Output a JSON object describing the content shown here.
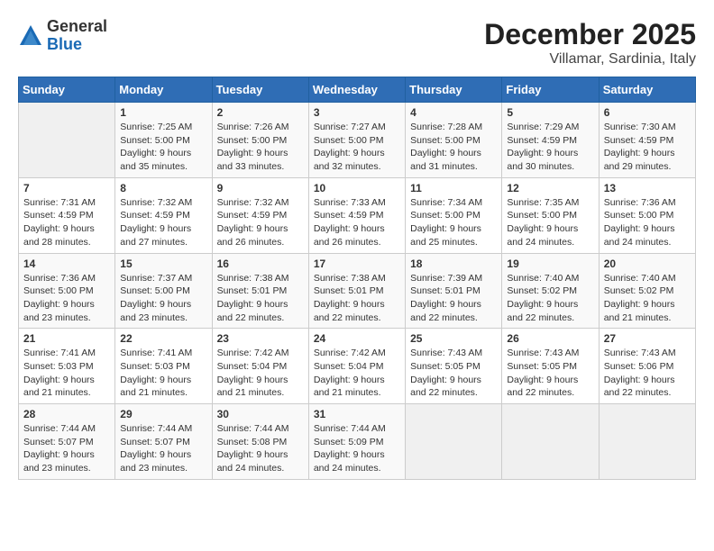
{
  "header": {
    "logo": {
      "general": "General",
      "blue": "Blue"
    },
    "title": "December 2025",
    "location": "Villamar, Sardinia, Italy"
  },
  "calendar": {
    "weekdays": [
      "Sunday",
      "Monday",
      "Tuesday",
      "Wednesday",
      "Thursday",
      "Friday",
      "Saturday"
    ],
    "weeks": [
      [
        {
          "day": "",
          "info": ""
        },
        {
          "day": "1",
          "info": "Sunrise: 7:25 AM\nSunset: 5:00 PM\nDaylight: 9 hours\nand 35 minutes."
        },
        {
          "day": "2",
          "info": "Sunrise: 7:26 AM\nSunset: 5:00 PM\nDaylight: 9 hours\nand 33 minutes."
        },
        {
          "day": "3",
          "info": "Sunrise: 7:27 AM\nSunset: 5:00 PM\nDaylight: 9 hours\nand 32 minutes."
        },
        {
          "day": "4",
          "info": "Sunrise: 7:28 AM\nSunset: 5:00 PM\nDaylight: 9 hours\nand 31 minutes."
        },
        {
          "day": "5",
          "info": "Sunrise: 7:29 AM\nSunset: 4:59 PM\nDaylight: 9 hours\nand 30 minutes."
        },
        {
          "day": "6",
          "info": "Sunrise: 7:30 AM\nSunset: 4:59 PM\nDaylight: 9 hours\nand 29 minutes."
        }
      ],
      [
        {
          "day": "7",
          "info": "Sunrise: 7:31 AM\nSunset: 4:59 PM\nDaylight: 9 hours\nand 28 minutes."
        },
        {
          "day": "8",
          "info": "Sunrise: 7:32 AM\nSunset: 4:59 PM\nDaylight: 9 hours\nand 27 minutes."
        },
        {
          "day": "9",
          "info": "Sunrise: 7:32 AM\nSunset: 4:59 PM\nDaylight: 9 hours\nand 26 minutes."
        },
        {
          "day": "10",
          "info": "Sunrise: 7:33 AM\nSunset: 4:59 PM\nDaylight: 9 hours\nand 26 minutes."
        },
        {
          "day": "11",
          "info": "Sunrise: 7:34 AM\nSunset: 5:00 PM\nDaylight: 9 hours\nand 25 minutes."
        },
        {
          "day": "12",
          "info": "Sunrise: 7:35 AM\nSunset: 5:00 PM\nDaylight: 9 hours\nand 24 minutes."
        },
        {
          "day": "13",
          "info": "Sunrise: 7:36 AM\nSunset: 5:00 PM\nDaylight: 9 hours\nand 24 minutes."
        }
      ],
      [
        {
          "day": "14",
          "info": "Sunrise: 7:36 AM\nSunset: 5:00 PM\nDaylight: 9 hours\nand 23 minutes."
        },
        {
          "day": "15",
          "info": "Sunrise: 7:37 AM\nSunset: 5:00 PM\nDaylight: 9 hours\nand 23 minutes."
        },
        {
          "day": "16",
          "info": "Sunrise: 7:38 AM\nSunset: 5:01 PM\nDaylight: 9 hours\nand 22 minutes."
        },
        {
          "day": "17",
          "info": "Sunrise: 7:38 AM\nSunset: 5:01 PM\nDaylight: 9 hours\nand 22 minutes."
        },
        {
          "day": "18",
          "info": "Sunrise: 7:39 AM\nSunset: 5:01 PM\nDaylight: 9 hours\nand 22 minutes."
        },
        {
          "day": "19",
          "info": "Sunrise: 7:40 AM\nSunset: 5:02 PM\nDaylight: 9 hours\nand 22 minutes."
        },
        {
          "day": "20",
          "info": "Sunrise: 7:40 AM\nSunset: 5:02 PM\nDaylight: 9 hours\nand 21 minutes."
        }
      ],
      [
        {
          "day": "21",
          "info": "Sunrise: 7:41 AM\nSunset: 5:03 PM\nDaylight: 9 hours\nand 21 minutes."
        },
        {
          "day": "22",
          "info": "Sunrise: 7:41 AM\nSunset: 5:03 PM\nDaylight: 9 hours\nand 21 minutes."
        },
        {
          "day": "23",
          "info": "Sunrise: 7:42 AM\nSunset: 5:04 PM\nDaylight: 9 hours\nand 21 minutes."
        },
        {
          "day": "24",
          "info": "Sunrise: 7:42 AM\nSunset: 5:04 PM\nDaylight: 9 hours\nand 21 minutes."
        },
        {
          "day": "25",
          "info": "Sunrise: 7:43 AM\nSunset: 5:05 PM\nDaylight: 9 hours\nand 22 minutes."
        },
        {
          "day": "26",
          "info": "Sunrise: 7:43 AM\nSunset: 5:05 PM\nDaylight: 9 hours\nand 22 minutes."
        },
        {
          "day": "27",
          "info": "Sunrise: 7:43 AM\nSunset: 5:06 PM\nDaylight: 9 hours\nand 22 minutes."
        }
      ],
      [
        {
          "day": "28",
          "info": "Sunrise: 7:44 AM\nSunset: 5:07 PM\nDaylight: 9 hours\nand 23 minutes."
        },
        {
          "day": "29",
          "info": "Sunrise: 7:44 AM\nSunset: 5:07 PM\nDaylight: 9 hours\nand 23 minutes."
        },
        {
          "day": "30",
          "info": "Sunrise: 7:44 AM\nSunset: 5:08 PM\nDaylight: 9 hours\nand 24 minutes."
        },
        {
          "day": "31",
          "info": "Sunrise: 7:44 AM\nSunset: 5:09 PM\nDaylight: 9 hours\nand 24 minutes."
        },
        {
          "day": "",
          "info": ""
        },
        {
          "day": "",
          "info": ""
        },
        {
          "day": "",
          "info": ""
        }
      ]
    ]
  }
}
